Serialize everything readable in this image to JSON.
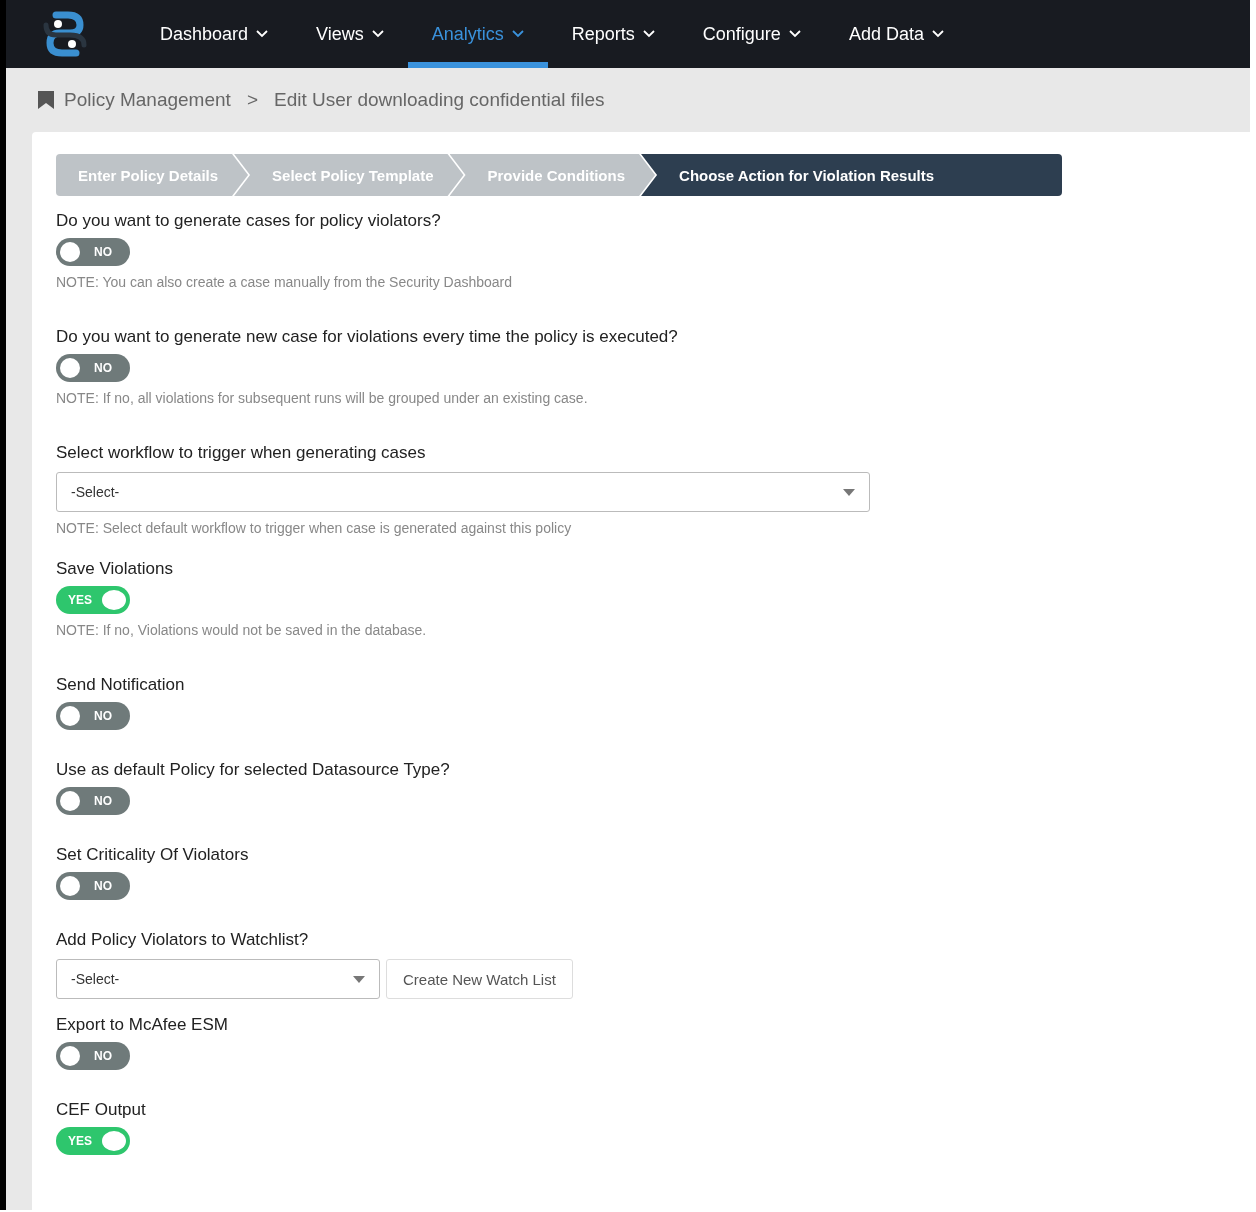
{
  "nav": {
    "items": [
      {
        "label": "Dashboard",
        "selected": false
      },
      {
        "label": "Views",
        "selected": false
      },
      {
        "label": "Analytics",
        "selected": true
      },
      {
        "label": "Reports",
        "selected": false
      },
      {
        "label": "Configure",
        "selected": false
      },
      {
        "label": "Add Data",
        "selected": false
      }
    ]
  },
  "breadcrumb": {
    "parent": "Policy Management",
    "separator": ">",
    "current": "Edit User downloading confidential files"
  },
  "steps": [
    {
      "label": "Enter Policy Details",
      "selected": false
    },
    {
      "label": "Select Policy Template",
      "selected": false
    },
    {
      "label": "Provide Conditions",
      "selected": false
    },
    {
      "label": "Choose Action for Violation Results",
      "selected": true
    }
  ],
  "fields": [
    {
      "kind": "toggle",
      "label": "Do you want to generate cases for policy violators?",
      "on": false,
      "text": "NO",
      "note": "NOTE: You can also create a case manually from the Security Dashboard"
    },
    {
      "kind": "toggle",
      "label": "Do you want to generate new case for violations every time the policy is executed?",
      "on": false,
      "text": "NO",
      "note": "NOTE: If no, all violations for subsequent runs will be grouped under an existing case."
    },
    {
      "kind": "select",
      "label": "Select workflow to trigger when generating cases",
      "value": "-Select-",
      "note": "NOTE: Select default workflow to trigger when case is generated against this policy"
    },
    {
      "kind": "toggle",
      "label": "Save Violations",
      "on": true,
      "text": "YES",
      "note": "NOTE: If no, Violations would not be saved in the database."
    },
    {
      "kind": "toggle",
      "label": "Send Notification",
      "on": false,
      "text": "NO"
    },
    {
      "kind": "toggle",
      "label": "Use as default Policy for selected Datasource Type?",
      "on": false,
      "text": "NO"
    },
    {
      "kind": "toggle",
      "label": "Set Criticality Of Violators",
      "on": false,
      "text": "NO"
    },
    {
      "kind": "select_button",
      "label": "Add Policy Violators to Watchlist?",
      "value": "-Select-",
      "button": "Create New Watch List"
    },
    {
      "kind": "toggle",
      "label": "Export to McAfee ESM",
      "on": false,
      "text": "NO"
    },
    {
      "kind": "toggle",
      "label": "CEF Output",
      "on": true,
      "text": "YES"
    }
  ]
}
